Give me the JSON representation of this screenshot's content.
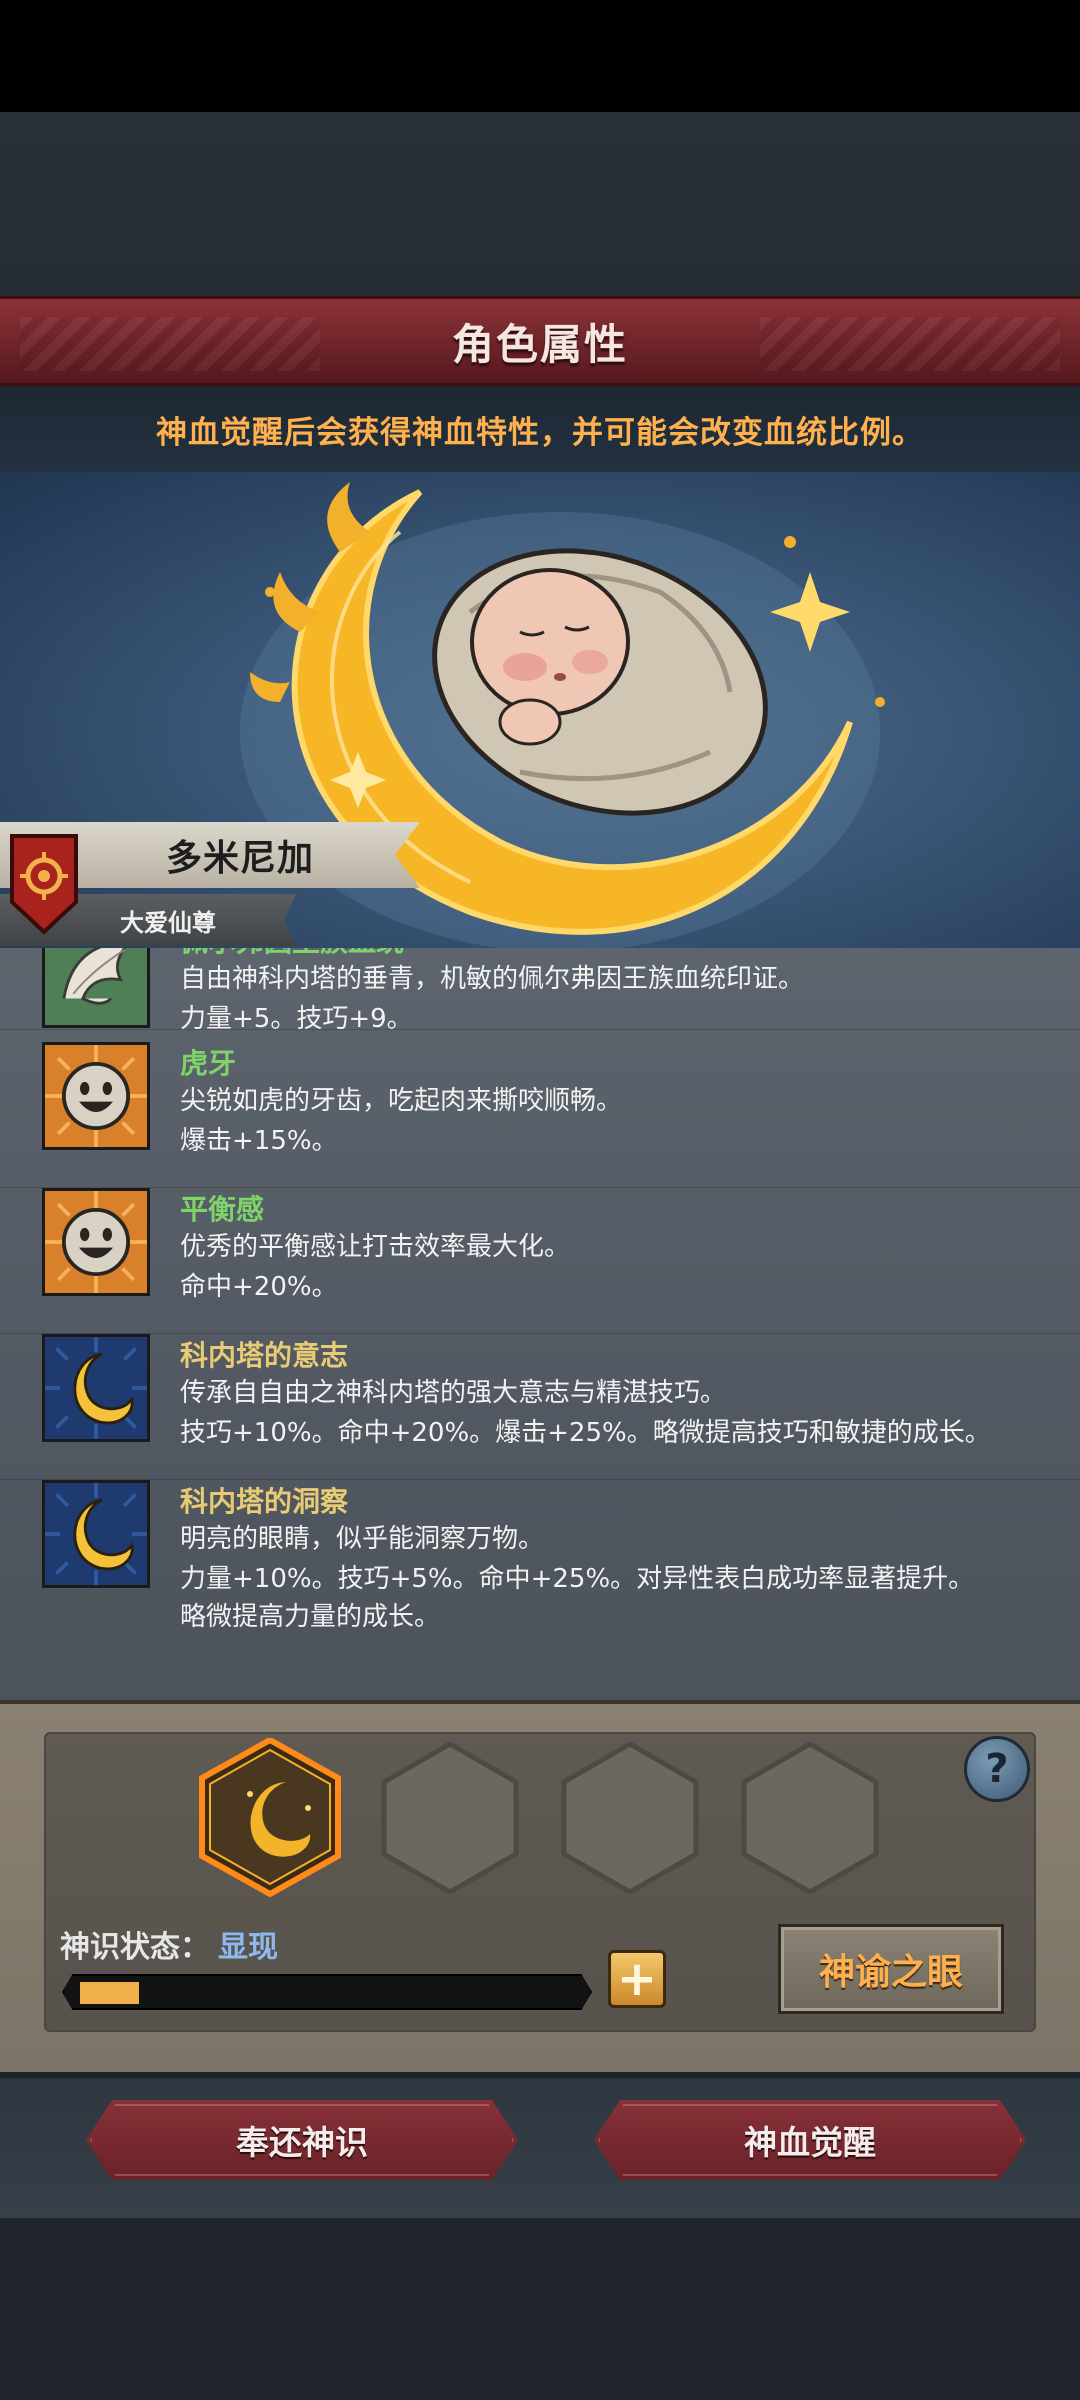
{
  "header": {
    "title": "角色属性"
  },
  "subtitle": "神血觉醒后会获得神血特性，并可能会改变血统比例。",
  "character": {
    "name": "多米尼加",
    "title": "大爱仙尊"
  },
  "traits": [
    {
      "name": "佩尔弗因王族血统",
      "desc": "自由神科内塔的垂青，机敏的佩尔弗因王族血统印证。",
      "stats": "力量+5。技巧+9。",
      "extra": "",
      "icon": "white-feather-icon",
      "name_color": "#7ed46a"
    },
    {
      "name": "虎牙",
      "desc": "尖锐如虎的牙齿，吃起肉来撕咬顺畅。",
      "stats": "爆击+15%。",
      "extra": "",
      "icon": "smiley-face-icon",
      "name_color": "#7ed46a"
    },
    {
      "name": "平衡感",
      "desc": "优秀的平衡感让打击效率最大化。",
      "stats": "命中+20%。",
      "extra": "",
      "icon": "smiley-face-icon",
      "name_color": "#7ed46a"
    },
    {
      "name": "科内塔的意志",
      "desc": "传承自自由之神科内塔的强大意志与精湛技巧。",
      "stats": "技巧+10%。命中+20%。爆击+25%。略微提高技巧和敏捷的成长。",
      "extra": "",
      "icon": "golden-crescent-icon",
      "name_color": "#e8cb74"
    },
    {
      "name": "科内塔的洞察",
      "desc": "明亮的眼睛，似乎能洞察万物。",
      "stats": "力量+10%。技巧+5%。命中+25%。对异性表白成功率显著提升。",
      "extra": "略微提高力量的成长。",
      "icon": "golden-crescent-icon",
      "name_color": "#e8cb74"
    }
  ],
  "slots": {
    "help": "?",
    "state_label": "神识状态：",
    "state_value": "显现",
    "progress": 0.12,
    "plus": "+",
    "oracle_button": "神谕之眼"
  },
  "actions": {
    "return_label": "奉还神识",
    "awaken_label": "神血觉醒"
  }
}
